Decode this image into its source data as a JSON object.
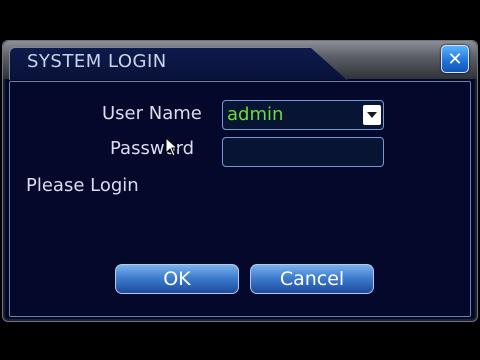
{
  "dialog": {
    "title": "SYSTEM LOGIN",
    "close_icon": "close-icon"
  },
  "form": {
    "username_label": "User Name",
    "username_value": "admin",
    "password_label": "Password",
    "password_value": "",
    "status_text": "Please Login"
  },
  "buttons": {
    "ok_label": "OK",
    "cancel_label": "Cancel"
  },
  "colors": {
    "panel_bg": "#03092a",
    "field_text": "#6bdc3c",
    "button_blue": "#3f7ed0",
    "close_blue": "#1f6fd8"
  }
}
